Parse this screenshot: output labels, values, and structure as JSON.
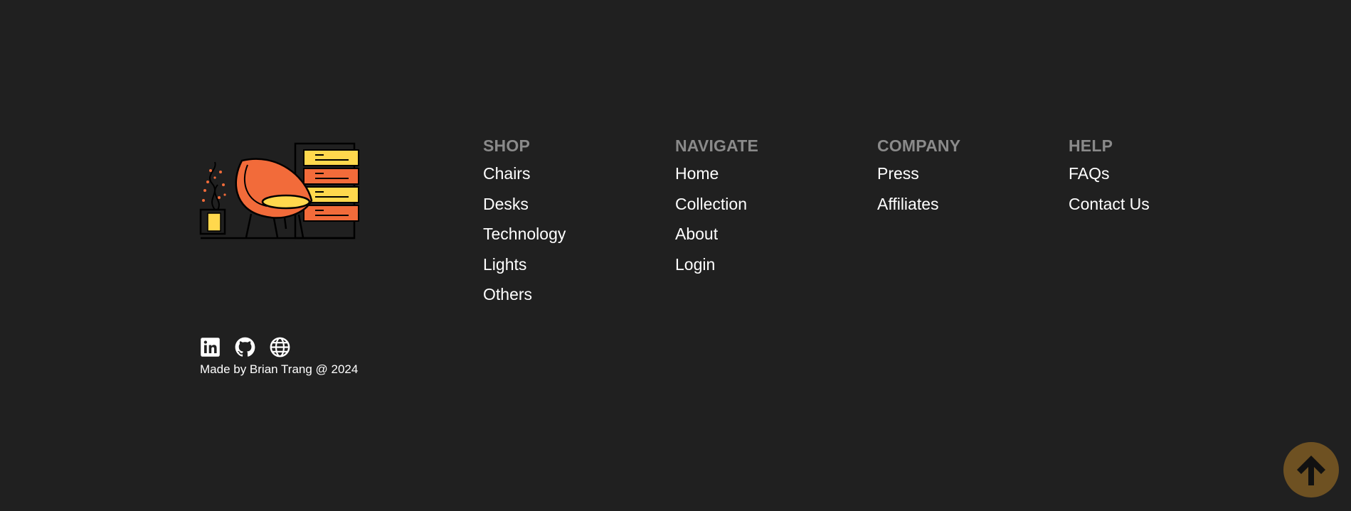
{
  "brand": {
    "logo_icon": "furniture-logo-icon"
  },
  "social": {
    "linkedin_icon": "linkedin-icon",
    "github_icon": "github-icon",
    "website_icon": "globe-icon"
  },
  "credit": "Made by Brian Trang @ 2024",
  "columns": {
    "shop": {
      "heading": "SHOP",
      "links": [
        "Chairs",
        "Desks",
        "Technology",
        "Lights",
        "Others"
      ]
    },
    "navigate": {
      "heading": "NAVIGATE",
      "links": [
        "Home",
        "Collection",
        "About",
        "Login"
      ]
    },
    "company": {
      "heading": "COMPANY",
      "links": [
        "Press",
        "Affiliates"
      ]
    },
    "help": {
      "heading": "HELP",
      "links": [
        "FAQs",
        "Contact Us"
      ]
    }
  },
  "scroll_top": {
    "icon": "arrow-up-icon"
  },
  "colors": {
    "background": "#202020",
    "heading": "#8a8a8a",
    "text": "#ffffff",
    "accent_orange": "#f26b3a",
    "accent_yellow": "#ffd84d",
    "scroll_button": "#6e5122"
  }
}
